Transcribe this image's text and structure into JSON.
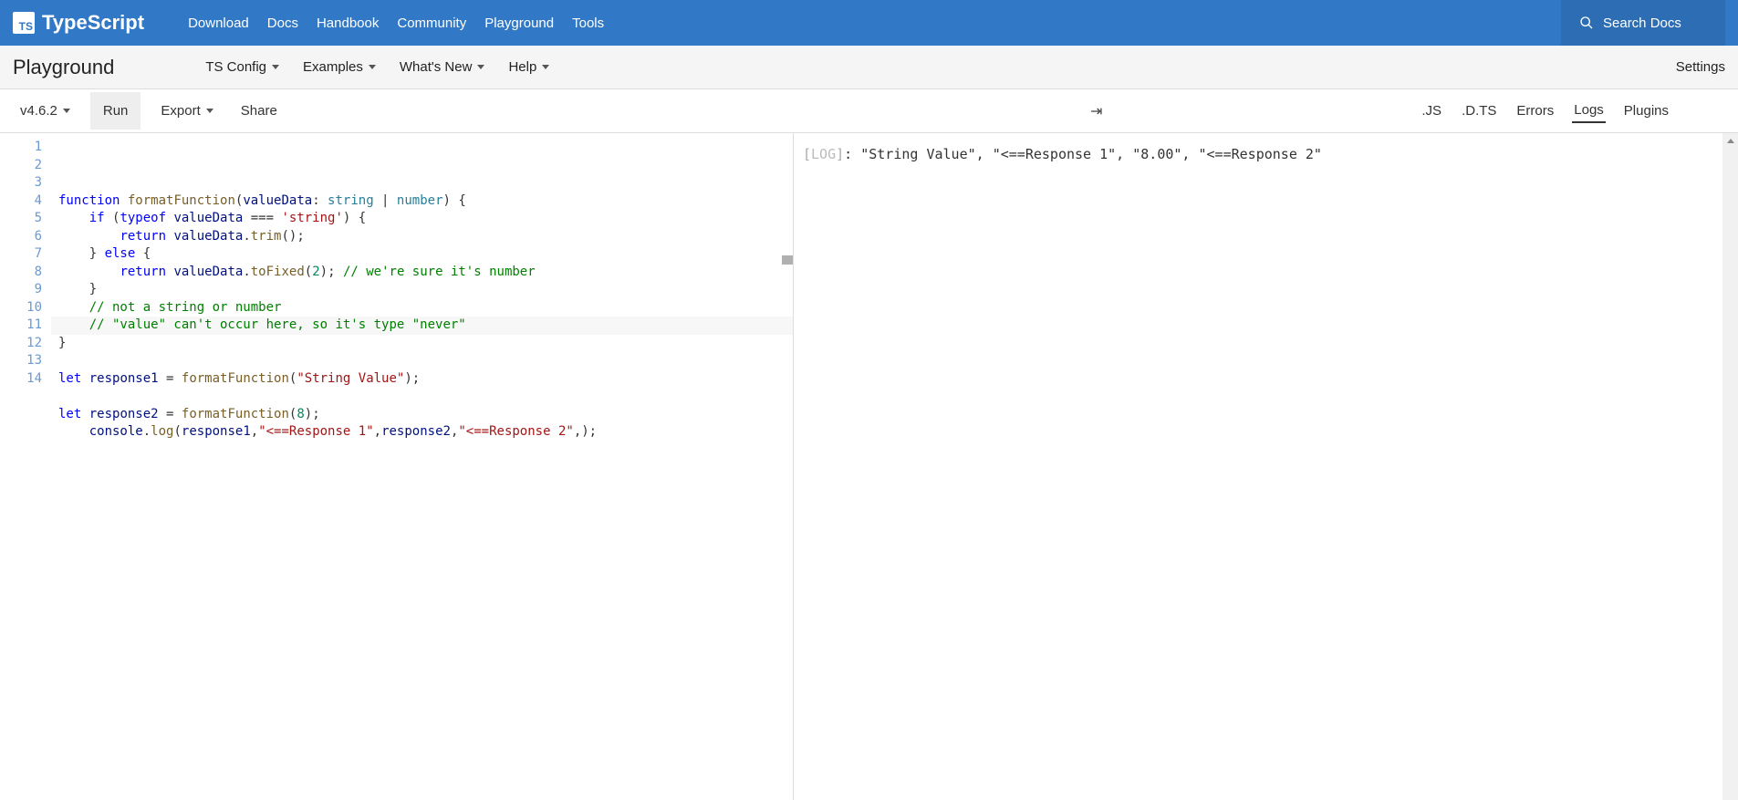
{
  "header": {
    "brand": "TypeScript",
    "logo_short": "TS",
    "links": [
      "Download",
      "Docs",
      "Handbook",
      "Community",
      "Playground",
      "Tools"
    ],
    "search_placeholder": "Search Docs"
  },
  "subnav": {
    "title": "Playground",
    "items": [
      "TS Config",
      "Examples",
      "What's New",
      "Help"
    ],
    "settings": "Settings"
  },
  "toolbar": {
    "version": "v4.6.2",
    "run": "Run",
    "export": "Export",
    "share": "Share",
    "arrow": "⇥"
  },
  "editor": {
    "line_count": 14,
    "highlighted_line": 11,
    "lines": [
      [
        {
          "t": "function",
          "c": "kw"
        },
        {
          "t": " "
        },
        {
          "t": "formatFunction",
          "c": "fn"
        },
        {
          "t": "("
        },
        {
          "t": "valueData",
          "c": "id"
        },
        {
          "t": ": "
        },
        {
          "t": "string",
          "c": "type"
        },
        {
          "t": " | "
        },
        {
          "t": "number",
          "c": "type"
        },
        {
          "t": ") {"
        }
      ],
      [
        {
          "t": "    "
        },
        {
          "t": "if",
          "c": "kw"
        },
        {
          "t": " ("
        },
        {
          "t": "typeof",
          "c": "kw"
        },
        {
          "t": " "
        },
        {
          "t": "valueData",
          "c": "id"
        },
        {
          "t": " === "
        },
        {
          "t": "'string'",
          "c": "str"
        },
        {
          "t": ") {"
        }
      ],
      [
        {
          "t": "        "
        },
        {
          "t": "return",
          "c": "kw"
        },
        {
          "t": " "
        },
        {
          "t": "valueData",
          "c": "id"
        },
        {
          "t": "."
        },
        {
          "t": "trim",
          "c": "fn"
        },
        {
          "t": "();"
        }
      ],
      [
        {
          "t": "    } "
        },
        {
          "t": "else",
          "c": "kw"
        },
        {
          "t": " {"
        }
      ],
      [
        {
          "t": "        "
        },
        {
          "t": "return",
          "c": "kw"
        },
        {
          "t": " "
        },
        {
          "t": "valueData",
          "c": "id"
        },
        {
          "t": "."
        },
        {
          "t": "toFixed",
          "c": "fn"
        },
        {
          "t": "("
        },
        {
          "t": "2",
          "c": "num"
        },
        {
          "t": "); "
        },
        {
          "t": "// we're sure it's number",
          "c": "com"
        }
      ],
      [
        {
          "t": "    }"
        }
      ],
      [
        {
          "t": "    "
        },
        {
          "t": "// not a string or number",
          "c": "com"
        }
      ],
      [
        {
          "t": "    "
        },
        {
          "t": "// \"value\" can't occur here, so it's type \"never\"",
          "c": "com"
        }
      ],
      [
        {
          "t": "}"
        }
      ],
      [
        {
          "t": ""
        }
      ],
      [
        {
          "t": "let",
          "c": "kw"
        },
        {
          "t": " "
        },
        {
          "t": "response1",
          "c": "id"
        },
        {
          "t": " = "
        },
        {
          "t": "formatFunction",
          "c": "fn"
        },
        {
          "t": "("
        },
        {
          "t": "\"String Value\"",
          "c": "str"
        },
        {
          "t": ");"
        }
      ],
      [
        {
          "t": ""
        }
      ],
      [
        {
          "t": "let",
          "c": "kw"
        },
        {
          "t": " "
        },
        {
          "t": "response2",
          "c": "id"
        },
        {
          "t": " = "
        },
        {
          "t": "formatFunction",
          "c": "fn"
        },
        {
          "t": "("
        },
        {
          "t": "8",
          "c": "num"
        },
        {
          "t": ");"
        }
      ],
      [
        {
          "t": "    "
        },
        {
          "t": "console",
          "c": "id"
        },
        {
          "t": "."
        },
        {
          "t": "log",
          "c": "fn"
        },
        {
          "t": "("
        },
        {
          "t": "response1",
          "c": "id"
        },
        {
          "t": ","
        },
        {
          "t": "\"<==Response 1\"",
          "c": "str"
        },
        {
          "t": ","
        },
        {
          "t": "response2",
          "c": "id"
        },
        {
          "t": ","
        },
        {
          "t": "\"<==Response 2\"",
          "c": "str"
        },
        {
          "t": ",);"
        }
      ]
    ]
  },
  "output": {
    "tabs": [
      ".JS",
      ".D.TS",
      "Errors",
      "Logs",
      "Plugins"
    ],
    "active_tab": "Logs",
    "log_prefix": "[LOG]",
    "log_text": ": \"String Value\",  \"<==Response 1\",  \"8.00\",  \"<==Response 2\" "
  }
}
